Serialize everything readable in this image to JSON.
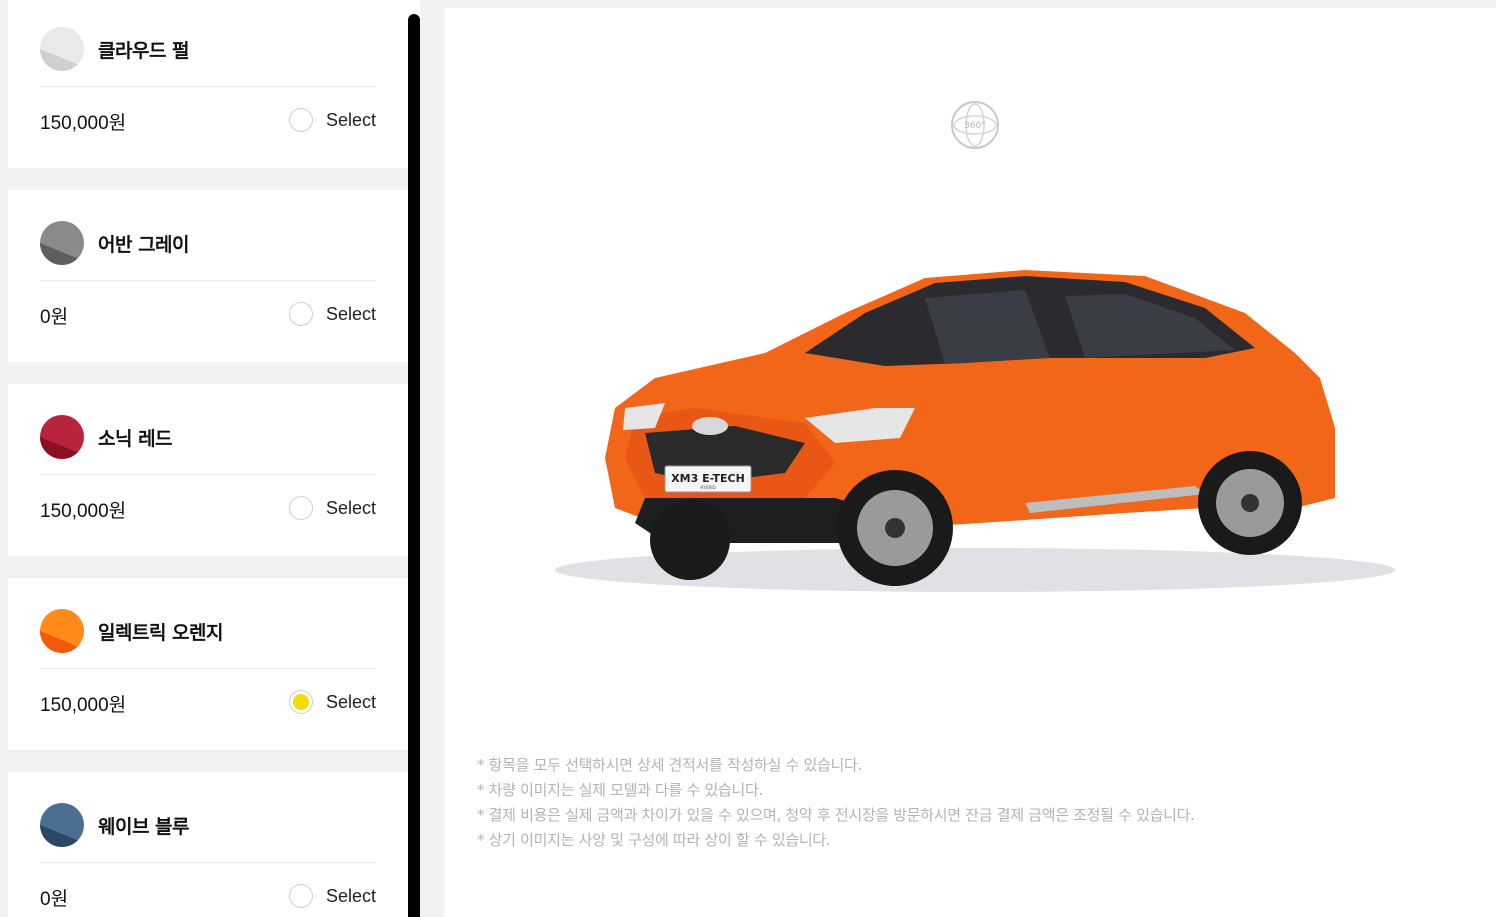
{
  "options": [
    {
      "name": "클라우드 펄",
      "price": "150,000원",
      "select_label": "Select",
      "selected": false,
      "colors": [
        "#e9e9e9",
        "#cfcfcf"
      ]
    },
    {
      "name": "어반 그레이",
      "price": "0원",
      "select_label": "Select",
      "selected": false,
      "colors": [
        "#8a8a8a",
        "#5e5e5e"
      ]
    },
    {
      "name": "소닉 레드",
      "price": "150,000원",
      "select_label": "Select",
      "selected": false,
      "colors": [
        "#b8233d",
        "#8c1024"
      ]
    },
    {
      "name": "일렉트릭 오렌지",
      "price": "150,000원",
      "select_label": "Select",
      "selected": true,
      "colors": [
        "#ff8a1a",
        "#f05a0a"
      ]
    },
    {
      "name": "웨이브 블루",
      "price": "0원",
      "select_label": "Select",
      "selected": false,
      "colors": [
        "#4a6f93",
        "#2a4866"
      ]
    }
  ],
  "view360_label": "360°",
  "car": {
    "plate_text": "XM3 E-TECH",
    "plate_sub": "HYBRID",
    "body_color": "#f2661a"
  },
  "notes": [
    "* 항목을 모두 선택하시면 상세 견적서를 작성하실 수 있습니다.",
    "* 차량 이미지는 실제 모델과 다를 수 있습니다.",
    "* 결제 비용은 실제 금액과 차이가 있을 수 있으며, 청약 후 전시장을 방문하시면 잔금 결제 금액은 조정될 수 있습니다.",
    "* 상기 이미지는 사양 및 구성에 따라 상이 할 수 있습니다."
  ]
}
